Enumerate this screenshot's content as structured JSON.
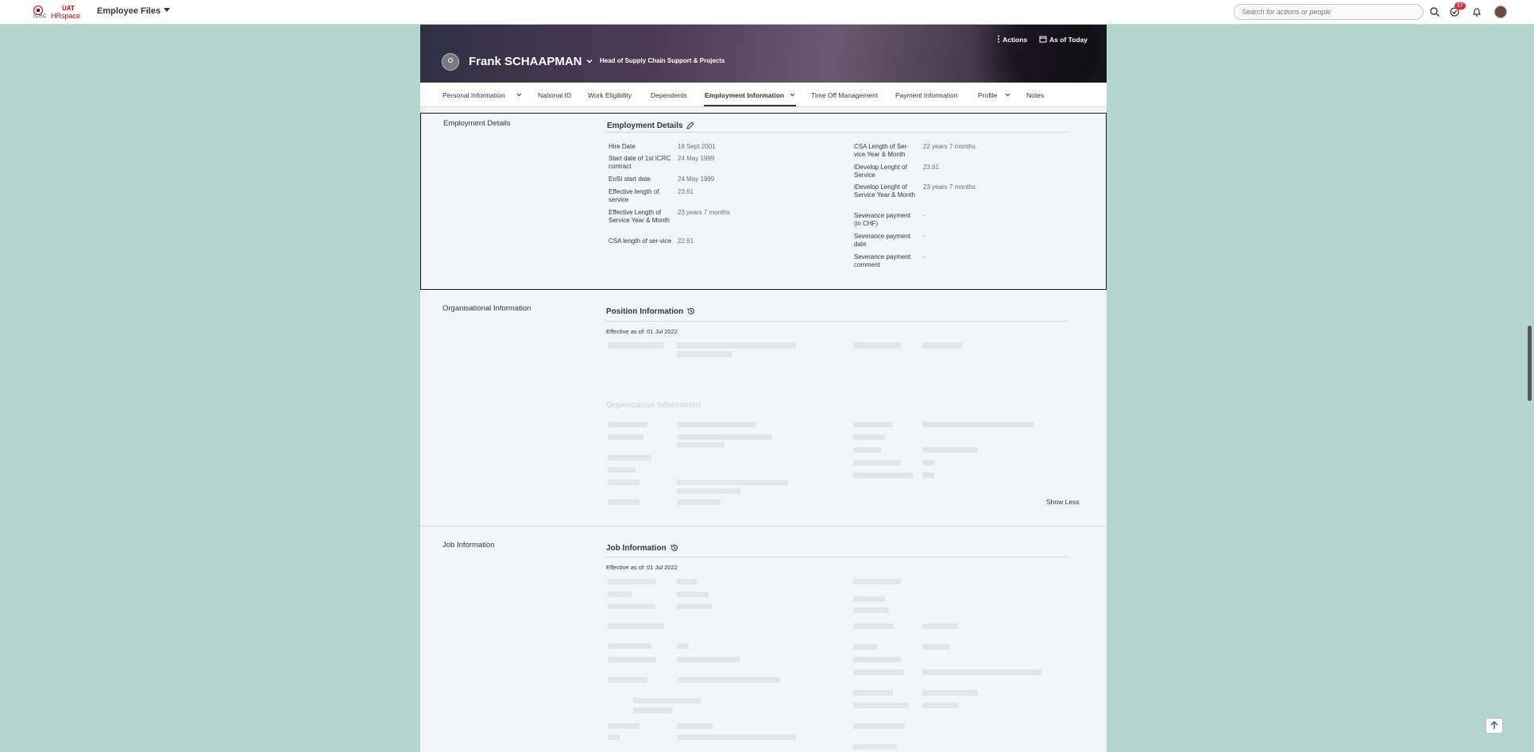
{
  "topbar": {
    "logo": {
      "icrc": "ICRC",
      "uat": "UAT",
      "hrspace": "HRspace"
    },
    "app_menu": "Employee Files",
    "search_placeholder": "Search for actions or people",
    "notifications_badge": "17"
  },
  "header": {
    "name": "Frank SCHAAPMAN",
    "title": "Head of Supply Chain Support & Projects",
    "actions_label": "Actions",
    "as_of_label": "As of Today"
  },
  "tabs": [
    {
      "label": "Personal Information",
      "has_menu": true
    },
    {
      "label": "National ID"
    },
    {
      "label": "Work Eligibility"
    },
    {
      "label": "Dependents"
    },
    {
      "label": "Employment Information",
      "has_menu": true,
      "active": true
    },
    {
      "label": "Time Off Management"
    },
    {
      "label": "Payment Information"
    },
    {
      "label": "Profile",
      "has_menu": true
    },
    {
      "label": "Notes"
    }
  ],
  "employment": {
    "section_label": "Employment Details",
    "card_title": "Employment Details",
    "left": [
      {
        "label": "Hire Date",
        "value": "18 Sept 2001"
      },
      {
        "label": "Start date of 1st ICRC contract",
        "value": "24 May 1999"
      },
      {
        "label": "EoSI start date",
        "value": "24 May 1999"
      },
      {
        "label": "Effective length of service",
        "value": "23.61"
      },
      {
        "label": "Effective Length of Service Year & Month",
        "value": "23 years 7 months"
      },
      {
        "label": "CSA length of ser-vice",
        "value": "22.61"
      }
    ],
    "right": [
      {
        "label": "CSA Length of Ser-vice Year & Month",
        "value": "22 years 7 months"
      },
      {
        "label": "iDevelop Lenght of Service",
        "value": "23.61"
      },
      {
        "label": "iDevelop Lenght of Service Year & Month",
        "value": "23 years 7 months"
      },
      {
        "label": "Severance payment (in CHF)",
        "value": "-"
      },
      {
        "label": "Severance payment date",
        "value": "-"
      },
      {
        "label": "Severance payment comment",
        "value": "-"
      }
    ]
  },
  "organisational": {
    "section_label": "Organisational Information",
    "card_title": "Position Information",
    "effective": "Effective as of: 01 Jul 2022",
    "sub_title": "Organization Information",
    "show_less": "Show Less"
  },
  "job": {
    "section_label": "Job Information",
    "card_title": "Job Information",
    "effective": "Effective as of: 01 Jul 2022"
  }
}
